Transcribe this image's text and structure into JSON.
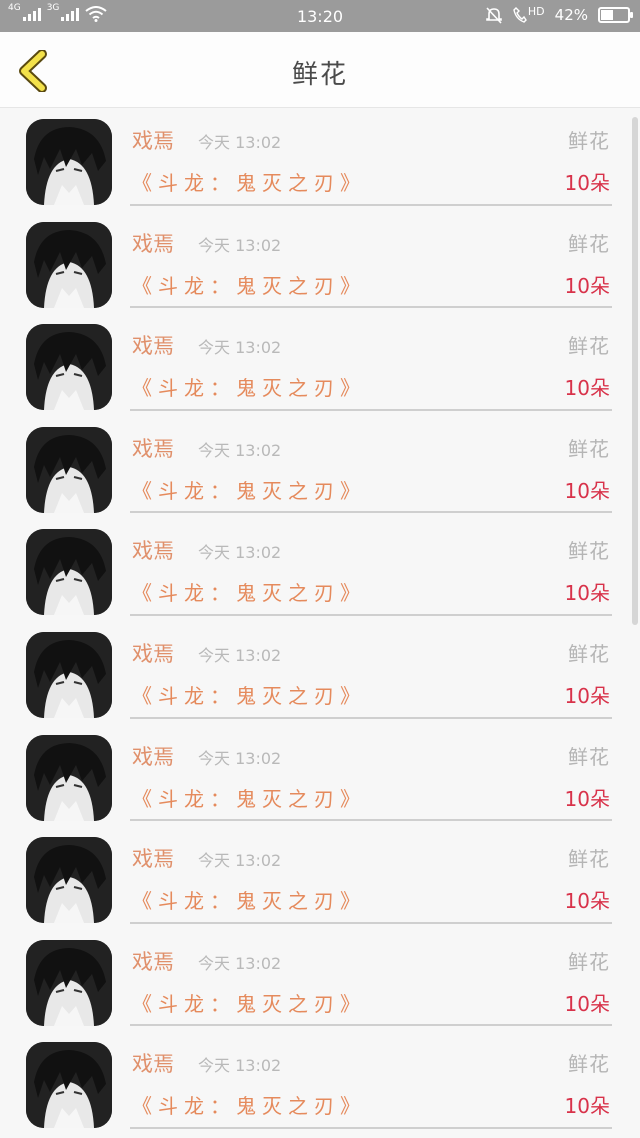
{
  "status_bar": {
    "net1": "4G",
    "net2": "3G",
    "time": "13:20",
    "hd": "HD",
    "battery": "42%",
    "battery_level": 0.42
  },
  "header": {
    "title": "鲜花"
  },
  "items": [
    {
      "name": "戏焉",
      "time": "今天 13:02",
      "type": "鲜花",
      "book": "《斗龙：鬼灭之刃》",
      "amount": "10朵"
    },
    {
      "name": "戏焉",
      "time": "今天 13:02",
      "type": "鲜花",
      "book": "《斗龙：鬼灭之刃》",
      "amount": "10朵"
    },
    {
      "name": "戏焉",
      "time": "今天 13:02",
      "type": "鲜花",
      "book": "《斗龙：鬼灭之刃》",
      "amount": "10朵"
    },
    {
      "name": "戏焉",
      "time": "今天 13:02",
      "type": "鲜花",
      "book": "《斗龙：鬼灭之刃》",
      "amount": "10朵"
    },
    {
      "name": "戏焉",
      "time": "今天 13:02",
      "type": "鲜花",
      "book": "《斗龙：鬼灭之刃》",
      "amount": "10朵"
    },
    {
      "name": "戏焉",
      "time": "今天 13:02",
      "type": "鲜花",
      "book": "《斗龙：鬼灭之刃》",
      "amount": "10朵"
    },
    {
      "name": "戏焉",
      "time": "今天 13:02",
      "type": "鲜花",
      "book": "《斗龙：鬼灭之刃》",
      "amount": "10朵"
    },
    {
      "name": "戏焉",
      "time": "今天 13:02",
      "type": "鲜花",
      "book": "《斗龙：鬼灭之刃》",
      "amount": "10朵"
    },
    {
      "name": "戏焉",
      "time": "今天 13:02",
      "type": "鲜花",
      "book": "《斗龙：鬼灭之刃》",
      "amount": "10朵"
    },
    {
      "name": "戏焉",
      "time": "今天 13:02",
      "type": "鲜花",
      "book": "《斗龙：鬼灭之刃》",
      "amount": "10朵"
    }
  ]
}
